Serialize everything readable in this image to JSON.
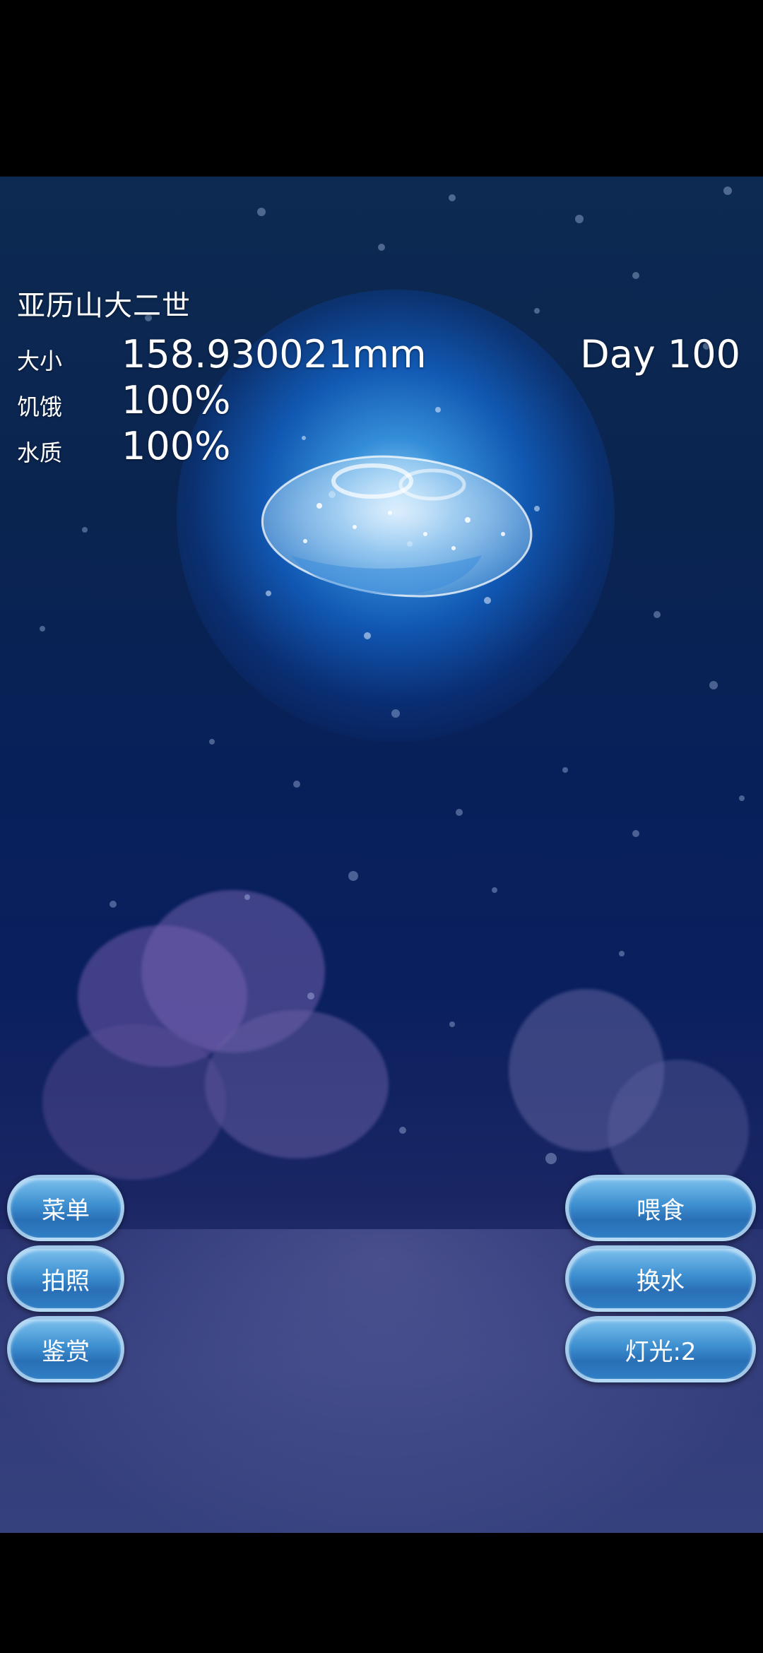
{
  "jellyfish": {
    "name": "亚历山大二世",
    "size_label": "大小",
    "size_value": "158.930021mm",
    "hunger_label": "饥饿",
    "hunger_value": "100%",
    "water_label": "水质",
    "water_value": "100%",
    "day": "Day 100"
  },
  "buttons_left": {
    "menu": "菜单",
    "photo": "拍照",
    "appreciate": "鉴赏"
  },
  "buttons_right": {
    "feed": "喂食",
    "change_water": "换水",
    "light": "灯光:2"
  },
  "colors": {
    "button_fill": "#3d8fd0",
    "water": "#0a2450",
    "spotlight": "#2a8ee8"
  }
}
